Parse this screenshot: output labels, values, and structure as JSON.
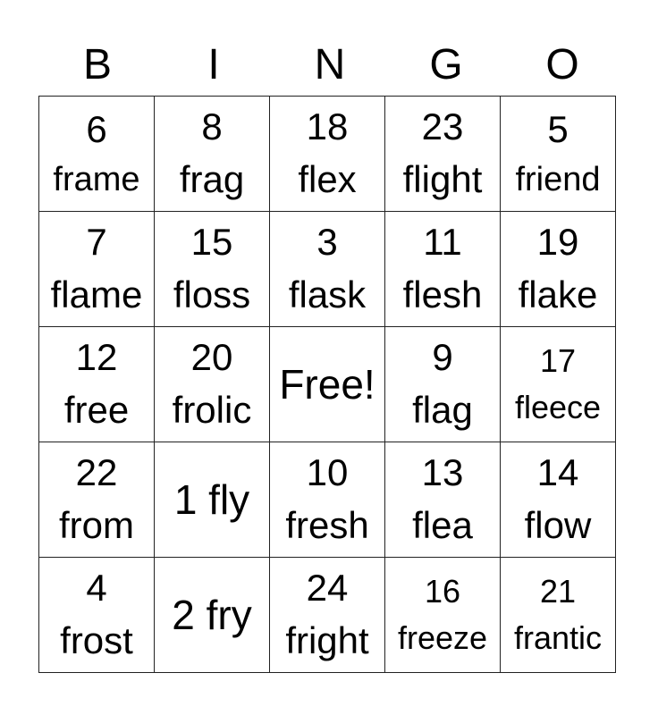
{
  "header": [
    "B",
    "I",
    "N",
    "G",
    "O"
  ],
  "rows": [
    [
      {
        "num": "6",
        "word": "frame",
        "size": "sm"
      },
      {
        "num": "8",
        "word": "frag"
      },
      {
        "num": "18",
        "word": "flex"
      },
      {
        "num": "23",
        "word": "flight"
      },
      {
        "num": "5",
        "word": "friend",
        "size": "sm"
      }
    ],
    [
      {
        "num": "7",
        "word": "flame"
      },
      {
        "num": "15",
        "word": "floss"
      },
      {
        "num": "3",
        "word": "flask"
      },
      {
        "num": "11",
        "word": "flesh"
      },
      {
        "num": "19",
        "word": "flake"
      }
    ],
    [
      {
        "num": "12",
        "word": "free"
      },
      {
        "num": "20",
        "word": "frolic"
      },
      {
        "single": "Free!"
      },
      {
        "num": "9",
        "word": "flag"
      },
      {
        "num": "17",
        "word": "fleece",
        "size": "xs"
      }
    ],
    [
      {
        "num": "22",
        "word": "from"
      },
      {
        "single": "1 fly"
      },
      {
        "num": "10",
        "word": "fresh"
      },
      {
        "num": "13",
        "word": "flea"
      },
      {
        "num": "14",
        "word": "flow"
      }
    ],
    [
      {
        "num": "4",
        "word": "frost"
      },
      {
        "single": "2 fry"
      },
      {
        "num": "24",
        "word": "fright"
      },
      {
        "num": "16",
        "word": "freeze",
        "size": "xs"
      },
      {
        "num": "21",
        "word": "frantic",
        "size": "xs"
      }
    ]
  ]
}
